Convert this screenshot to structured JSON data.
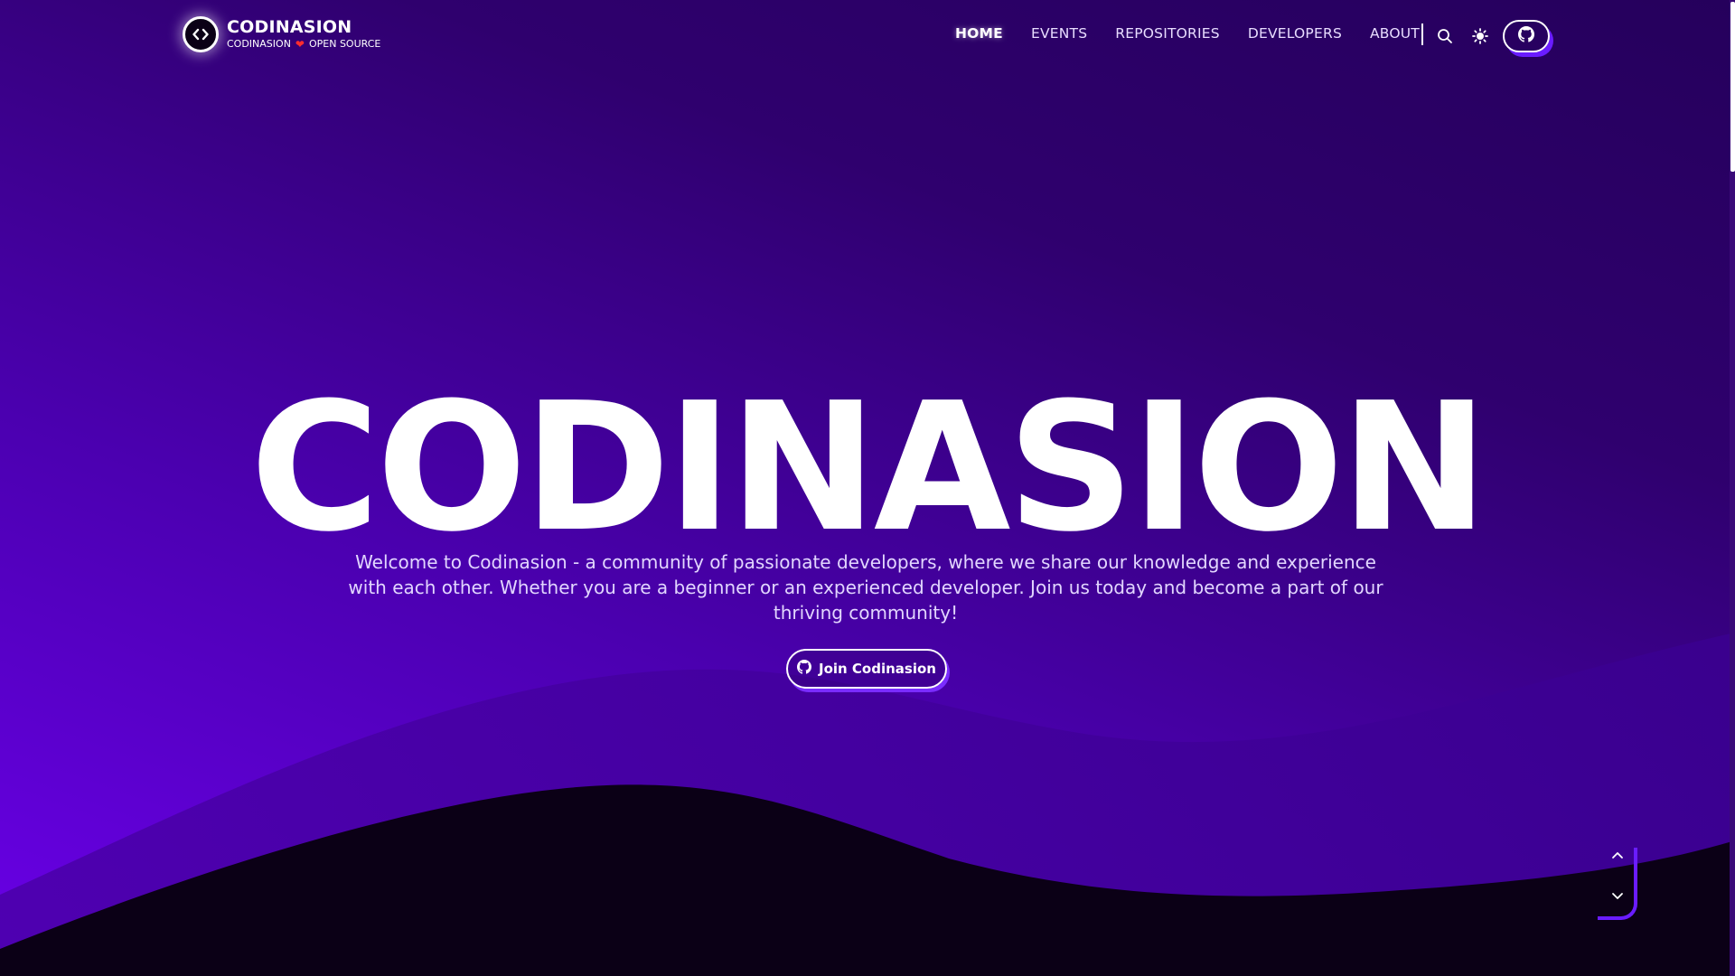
{
  "brand": {
    "title": "CODINASION",
    "sub_left": "CODINASION",
    "sub_right": "OPEN SOURCE"
  },
  "nav": {
    "items": [
      {
        "label": "HOME",
        "active": true
      },
      {
        "label": "EVENTS",
        "active": false
      },
      {
        "label": "REPOSITORIES",
        "active": false
      },
      {
        "label": "DEVELOPERS",
        "active": false
      },
      {
        "label": "ABOUT",
        "active": false
      }
    ]
  },
  "icons": {
    "logo": "code-brackets-icon",
    "heart": "heart-icon",
    "search": "search-icon",
    "theme": "sun-icon",
    "github": "github-icon",
    "scroll_up": "chevron-up-icon",
    "scroll_down": "chevron-down-icon"
  },
  "hero": {
    "title": "CODINASION",
    "description": "Welcome to Codinasion - a community of passionate developers, where we share our knowledge and experience with each other. Whether you are a beginner or an experienced developer. Join us today and become a part of our thriving community!",
    "cta_label": "Join Codinasion"
  },
  "colors": {
    "background_top": "#25005c",
    "background_bottom": "#6a00e8",
    "accent": "#6a1cff",
    "wave_dark": "#0b0016",
    "heart": "#ff2d2d"
  }
}
